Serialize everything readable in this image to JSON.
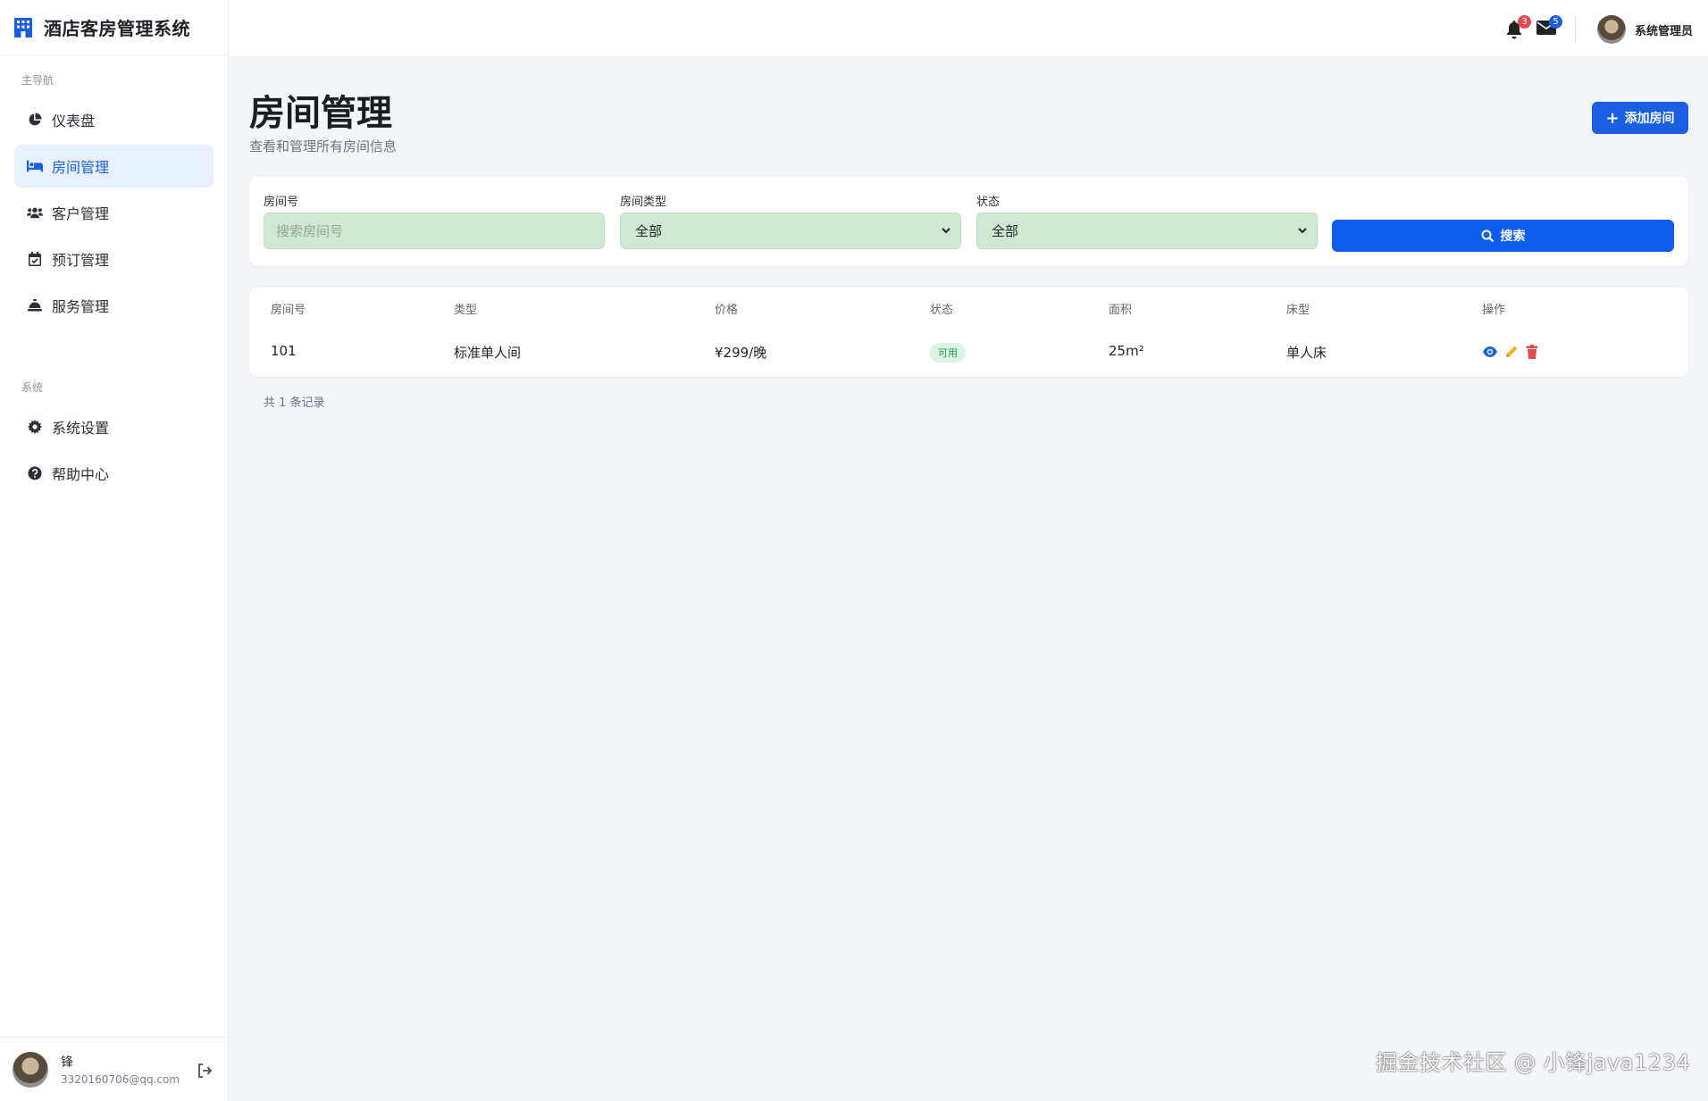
{
  "app": {
    "title": "酒店客房管理系统"
  },
  "sidebar": {
    "section_main": "主导航",
    "items": [
      {
        "label": "仪表盘",
        "icon": "pie-chart-icon",
        "active": false
      },
      {
        "label": "房间管理",
        "icon": "bed-icon",
        "active": true
      },
      {
        "label": "客户管理",
        "icon": "users-icon",
        "active": false
      },
      {
        "label": "预订管理",
        "icon": "calendar-check-icon",
        "active": false
      },
      {
        "label": "服务管理",
        "icon": "bell-concierge-icon",
        "active": false
      }
    ],
    "section_system": "系统",
    "system_items": [
      {
        "label": "系统设置",
        "icon": "gear-icon"
      },
      {
        "label": "帮助中心",
        "icon": "question-circle-icon"
      }
    ],
    "user": {
      "name": "锋",
      "email": "3320160706@qq.com"
    }
  },
  "header": {
    "notifications_count": "3",
    "messages_count": "5",
    "user_name": "系统管理员"
  },
  "page": {
    "title": "房间管理",
    "subtitle": "查看和管理所有房间信息",
    "add_button": "添加房间"
  },
  "filters": {
    "room_no_label": "房间号",
    "room_no_placeholder": "搜索房间号",
    "room_type_label": "房间类型",
    "room_type_value": "全部",
    "status_label": "状态",
    "status_value": "全部",
    "search_button": "搜索"
  },
  "table": {
    "columns": [
      "房间号",
      "类型",
      "价格",
      "状态",
      "面积",
      "床型",
      "操作"
    ],
    "rows": [
      {
        "room_no": "101",
        "type": "标准单人间",
        "price": "¥299/晚",
        "status": "可用",
        "area": "25m²",
        "bed": "单人床"
      }
    ],
    "record_count": "共 1 条记录"
  },
  "colors": {
    "primary": "#1a5fe0",
    "status_available_bg": "#dcf5e3",
    "status_available_text": "#1b9a4b",
    "view_icon": "#1a5fe0",
    "edit_icon": "#f0b429",
    "delete_icon": "#e5484d",
    "notification_badge": "#e5484d",
    "message_badge": "#1a5fe0"
  },
  "watermark": "掘金技术社区 @ 小锋java1234"
}
